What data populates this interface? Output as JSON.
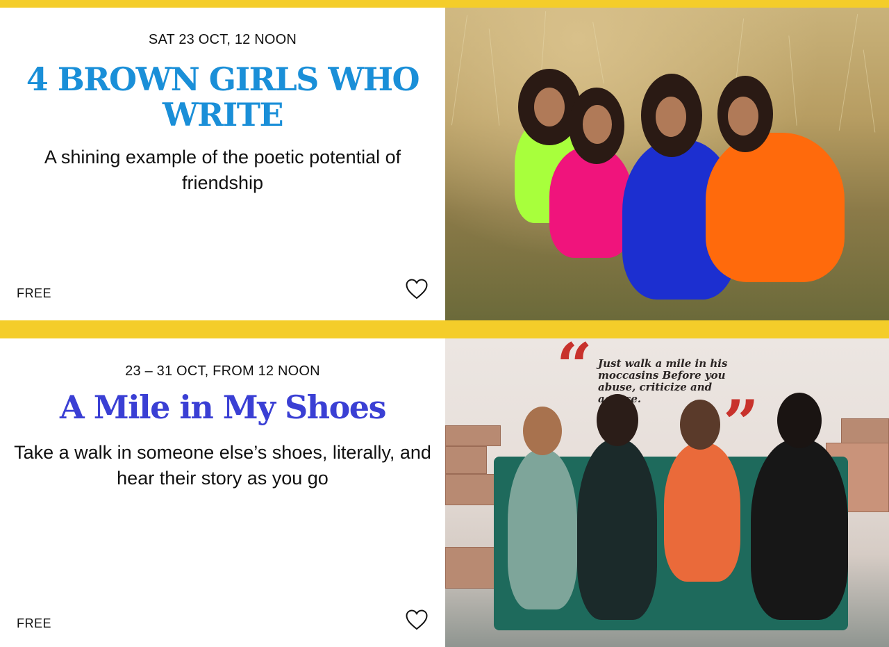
{
  "events": [
    {
      "date": "SAT 23 OCT, 12 NOON",
      "title": "4 BROWN GIRLS WHO WRITE",
      "description": "A shining example of the poetic potential of friendship",
      "price": "FREE",
      "favorite_icon": "heart-outline-icon",
      "photo": "four-women-in-grass-field",
      "title_color": "#1a8fd8"
    },
    {
      "date": "23 – 31 OCT, FROM 12 NOON",
      "title": "A Mile in My Shoes",
      "description": "Take a walk in someone else’s shoes, literally, and hear their story as you go",
      "price": "FREE",
      "favorite_icon": "heart-outline-icon",
      "photo": "women-with-headphones-on-sofa",
      "title_color": "#3a3fd4",
      "wall_quote": "Just walk a mile in his moccasins Before you abuse, criticize and accuse."
    }
  ],
  "theme": {
    "background": "#f4cd2a",
    "card": "#ffffff"
  }
}
